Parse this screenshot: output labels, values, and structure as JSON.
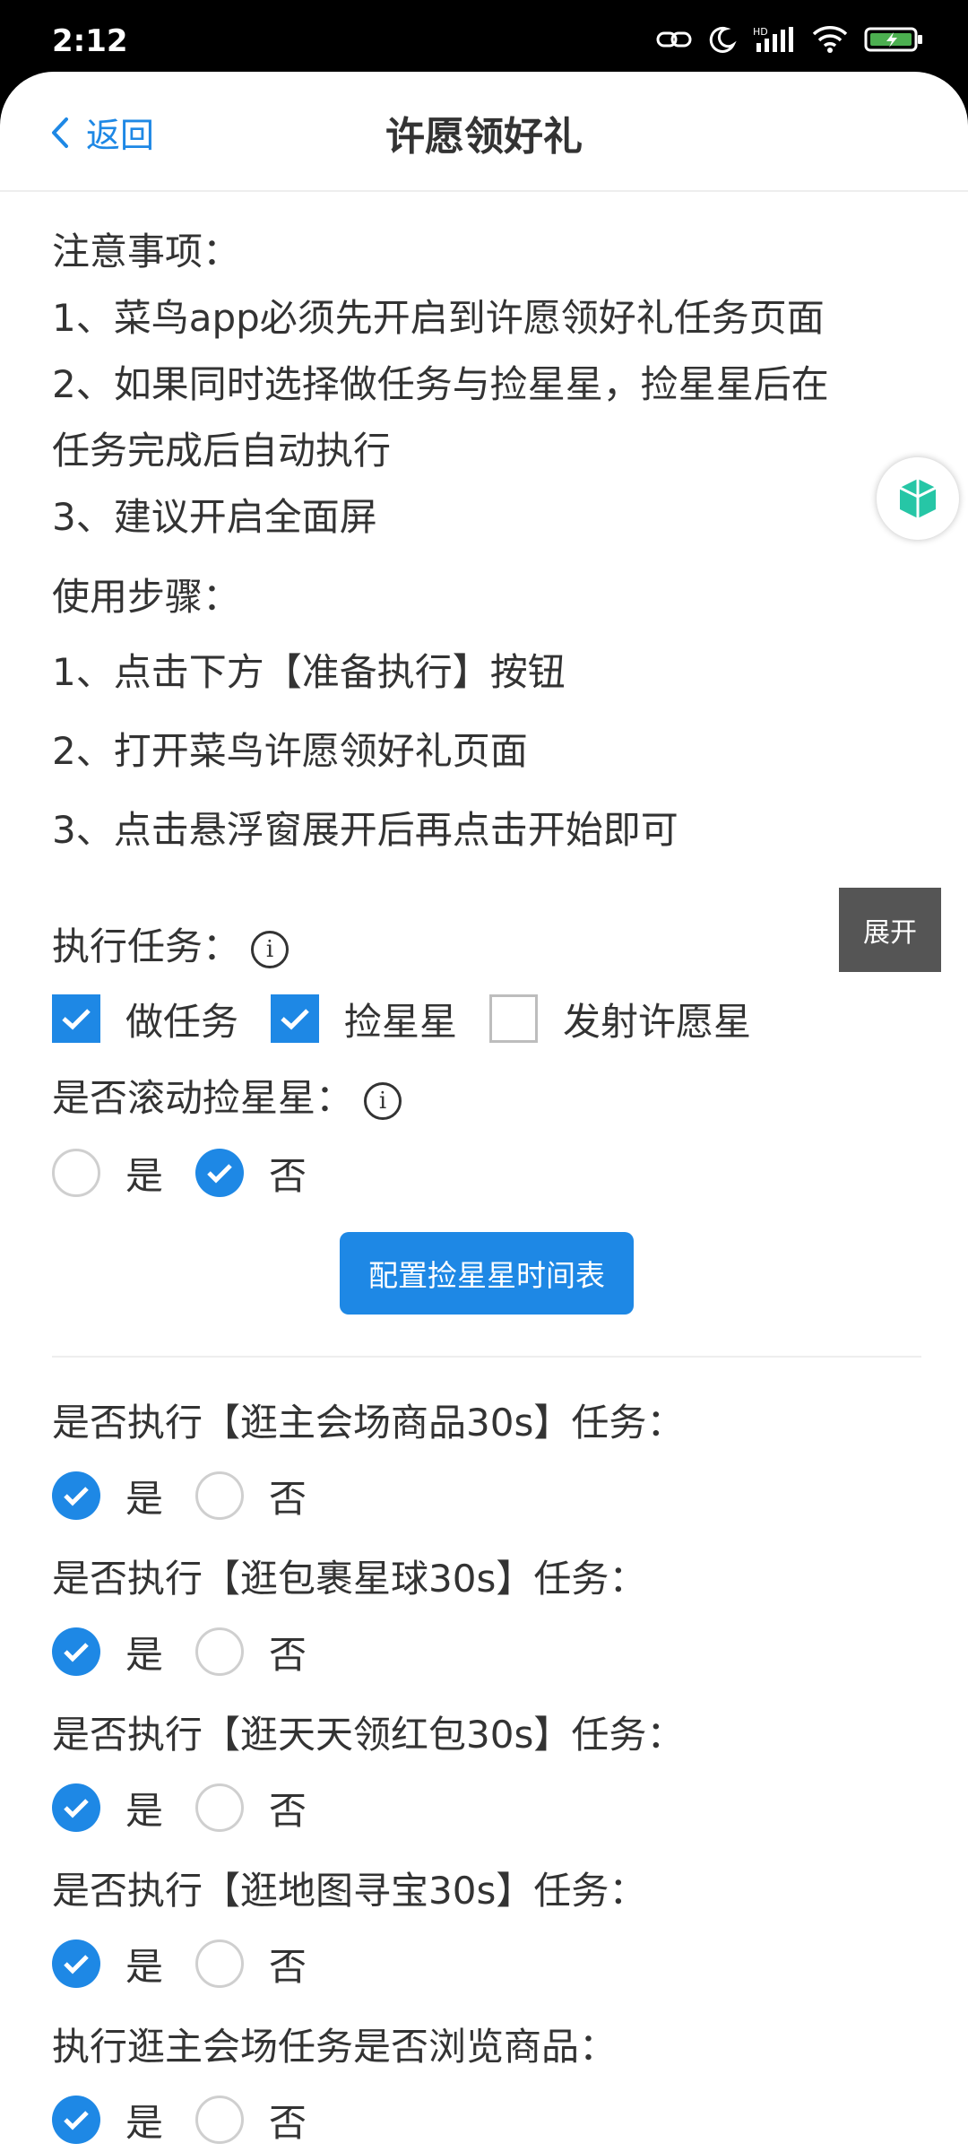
{
  "status_bar": {
    "time": "2:12"
  },
  "header": {
    "back_label": "返回",
    "title": "许愿领好礼"
  },
  "notes": {
    "title": "注意事项：",
    "items": [
      "1、菜鸟app必须先开启到许愿领好礼任务页面",
      "2、如果同时选择做任务与捡星星，捡星星后在",
      "任务完成后自动执行",
      "3、建议开启全面屏"
    ]
  },
  "steps": {
    "title": "使用步骤：",
    "items": [
      "1、点击下方【准备执行】按钮",
      "2、打开菜鸟许愿领好礼页面",
      "3、点击悬浮窗展开后再点击开始即可"
    ]
  },
  "tasks": {
    "label": "执行任务：",
    "info_glyph": "i",
    "options": [
      {
        "label": "做任务",
        "checked": true
      },
      {
        "label": "捡星星",
        "checked": true
      },
      {
        "label": "发射许愿星",
        "checked": false
      }
    ]
  },
  "scroll_stars": {
    "label": "是否滚动捡星星：",
    "info_glyph": "i",
    "yes": "是",
    "no": "否",
    "selected": "no"
  },
  "config_button": "配置捡星星时间表",
  "questions": [
    {
      "label": "是否执行【逛主会场商品30s】任务：",
      "yes": "是",
      "no": "否",
      "selected": "yes"
    },
    {
      "label": "是否执行【逛包裹星球30s】任务：",
      "yes": "是",
      "no": "否",
      "selected": "yes"
    },
    {
      "label": "是否执行【逛天天领红包30s】任务：",
      "yes": "是",
      "no": "否",
      "selected": "yes"
    },
    {
      "label": "是否执行【逛地图寻宝30s】任务：",
      "yes": "是",
      "no": "否",
      "selected": "yes"
    },
    {
      "label": "执行逛主会场任务是否浏览商品：",
      "yes": "是",
      "no": "否",
      "selected": "yes"
    }
  ],
  "float_button": "展开",
  "colors": {
    "accent": "#1e88e5",
    "float_bg": "#555555",
    "ball_icon": "#26c6a6"
  }
}
